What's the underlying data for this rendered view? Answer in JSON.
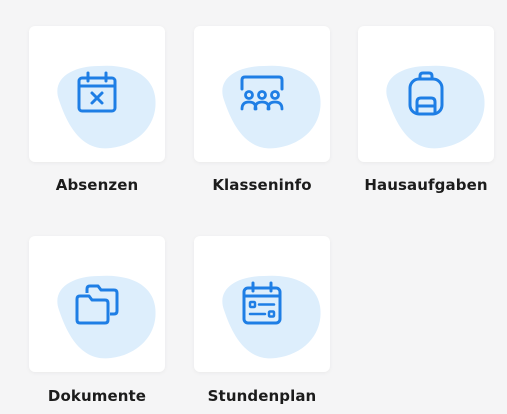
{
  "colors": {
    "background": "#f5f5f6",
    "card": "#ffffff",
    "blob": "#ddeefc",
    "icon": "#1e7ee5",
    "label": "#1c1c1c"
  },
  "tiles": [
    {
      "label": "Absenzen",
      "icon": "calendar-x-icon"
    },
    {
      "label": "Klasseninfo",
      "icon": "class-group-icon"
    },
    {
      "label": "Hausaufgaben",
      "icon": "backpack-icon"
    },
    {
      "label": "Dokumente",
      "icon": "folders-icon"
    },
    {
      "label": "Stundenplan",
      "icon": "calendar-timetable-icon"
    }
  ]
}
